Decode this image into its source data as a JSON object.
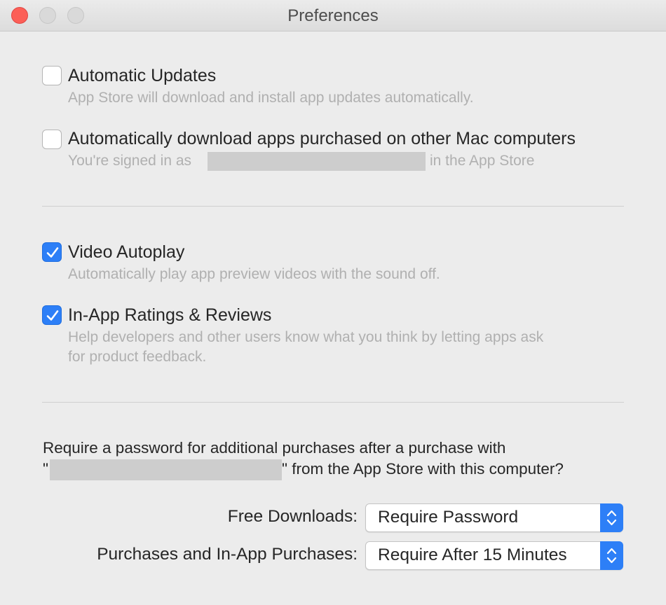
{
  "window": {
    "title": "Preferences"
  },
  "options": [
    {
      "title": "Automatic Updates",
      "description": "App Store will download and install app updates automatically.",
      "checked": false
    },
    {
      "title": "Automatically download apps purchased on other Mac computers",
      "description_prefix": "You're signed in as",
      "description_suffix": "in the App Store",
      "checked": false
    },
    {
      "title": "Video Autoplay",
      "description": "Automatically play app preview videos with the sound off.",
      "checked": true
    },
    {
      "title": "In-App Ratings & Reviews",
      "description_line1": "Help developers and other users know what you think by letting apps ask",
      "description_line2": "for product feedback.",
      "checked": true
    }
  ],
  "password": {
    "line1": "Require a password for additional purchases after a purchase with",
    "quote_open": "\"",
    "line2_suffix": "\" from the App Store with this computer?",
    "free_label": "Free Downloads:",
    "free_value": "Require Password",
    "purchases_label": "Purchases and In-App Purchases:",
    "purchases_value": "Require After 15 Minutes"
  },
  "colors": {
    "accent": "#2d7ff7",
    "close": "#fc5f57",
    "background": "#ececec"
  }
}
